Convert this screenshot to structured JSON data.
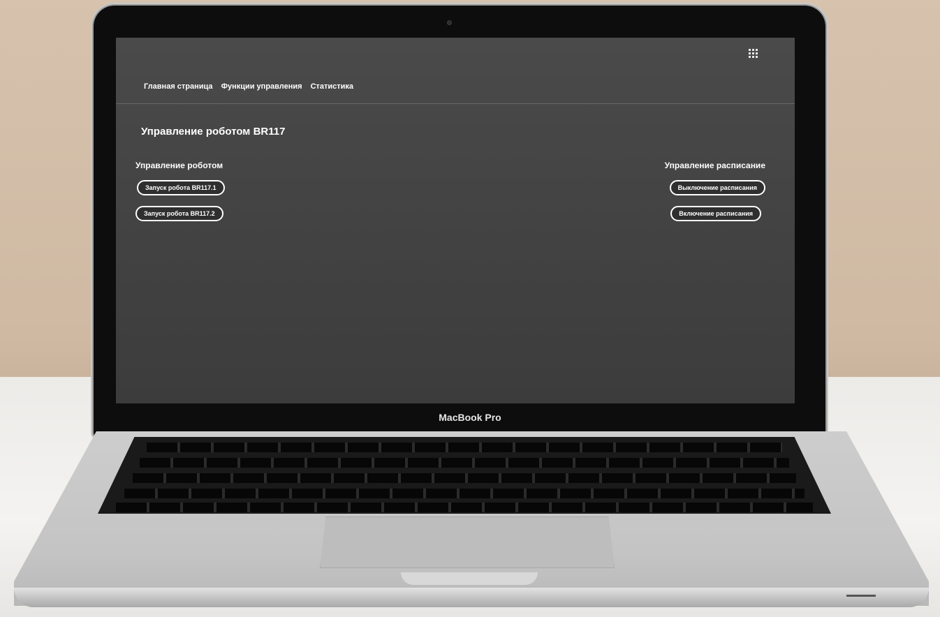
{
  "laptop": {
    "brand_label": "MacBook Pro"
  },
  "header": {
    "apps_icon": "grid-apps-icon",
    "nav": [
      {
        "label": "Главная страница"
      },
      {
        "label": "Функции управления"
      },
      {
        "label": "Статистика"
      }
    ]
  },
  "main": {
    "title": "Управление роботом BR117",
    "robot_section": {
      "title": "Управление роботом",
      "buttons": [
        {
          "label": "Запуск робота BR117.1"
        },
        {
          "label": "Запуск робота BR117.2"
        }
      ]
    },
    "schedule_section": {
      "title": "Управление расписание",
      "buttons": [
        {
          "label": "Выключение расписания"
        },
        {
          "label": "Включение расписания"
        }
      ]
    }
  },
  "colors": {
    "screen_bg": "#444444",
    "button_border": "#ffffff",
    "text": "#ffffff"
  }
}
